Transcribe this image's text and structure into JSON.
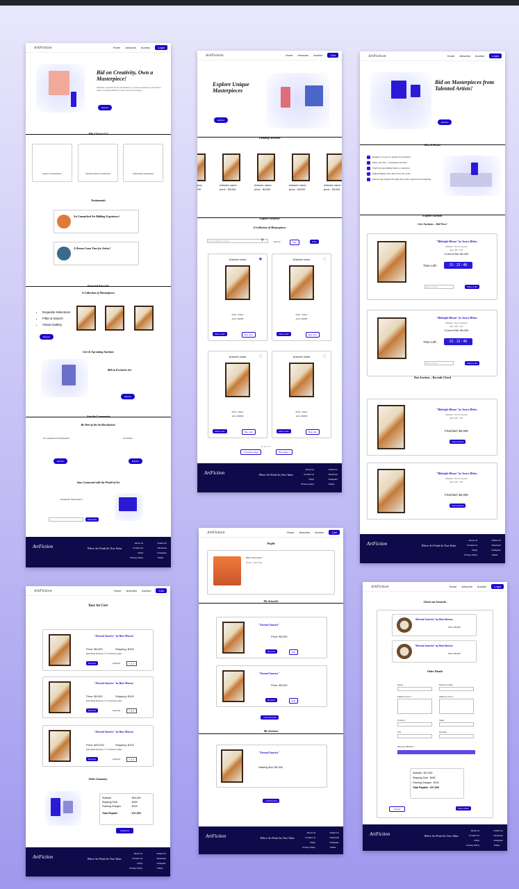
{
  "brand": "ArtFiction",
  "nav": {
    "home": "Home",
    "artworks": "Artworks",
    "auction": "Auction",
    "login": "Login",
    "cart": "Cart"
  },
  "home": {
    "title": "Bid on Creativity, Own a Masterpiece!",
    "hero_text": "Whether a seasoned art enthusiast or a curious newcomer, Art Fiction offers a unique platform to bid, connect and grow.",
    "explore": "Explore",
    "why": "Why Choose Us?",
    "features": [
      "Secure Transactions",
      "Verified Artists & Collectors",
      "Authenticity Guarantee"
    ],
    "testimonials": "Testimonials",
    "t1": "An Unmatched Art Bidding Experience!",
    "t2": "A Dream Come True for Artists!",
    "featured": "Featured Artworks",
    "collection": "A Collection of Masterpieces",
    "bullets": [
      "Exquisite Selections",
      "Filter & Search",
      "Virtual Gallery"
    ],
    "live": "Live & Upcoming Auctions",
    "bid_exclusive": "Bid on Exclusive Art",
    "join": "Join the Community",
    "revolution": "Be Part of the Art Revolution!",
    "collectors": "For Collectors & Enthusiasts",
    "artists": "For Artists",
    "stay": "Stay Connected with the World of Art",
    "newsletter": "Newsletter Subscription",
    "subscribe": "Subscribe"
  },
  "artworks": {
    "title": "Explore Unique Masterpieces",
    "trending": "Trending Artworks",
    "trend_item": "Artwork name",
    "trend_price": "price : $1000",
    "explore": "Explore Artworks",
    "collection": "A Collection of Masterpieces",
    "search_placeholder": "Type something for search",
    "sort": "Sort by :",
    "sort_title": "Title",
    "sort_price": "Price",
    "card_name": "Artwork name",
    "artist": "Artist : Name",
    "price": "price :$1000",
    "add": "Add to cart",
    "buy": "Buy now",
    "prev": "« Previous page",
    "next": "Next page »"
  },
  "auction": {
    "title": "Bid on Masterpieces from Talented Artists!",
    "how": "How It Works",
    "steps": [
      "Register or Log in to access live auctions",
      "Place your bid — transparent and fair",
      "Track the live bidding history in real-time",
      "Highest Bidder wins when the timer ends",
      "Secure your artwork through easy online payment and shipping"
    ],
    "explore": "Explore Auctions",
    "live": "Live Auctions – Bid Now!",
    "lot1": "\"Midnight Bloom\" by Aarya Mehta",
    "lot2": "\"Midnight Bloom\" by Aarya Mehta",
    "medium": "Medium: Oil on Canvas",
    "size": "Size: 30\" x 24\"",
    "current1": "Current Bid: $5,000",
    "current2": "Current Bid: $5,000",
    "time": "Time Left :",
    "timer1": "01 : 12 : 48",
    "timer2": "01 : 12 : 48",
    "enter": "Enter a amount",
    "place": "Place a bid",
    "past": "Past Auctions – Recently Closed",
    "final": "Final Bid: $2,000",
    "view": "View Artwork"
  },
  "cart": {
    "title": "Your Art Cart",
    "item1": "\"Eternal Sunrise\" by Ravi Menon",
    "price1": "Price: $5,000",
    "ship1": "Shipping: $100",
    "price3": "Price: $25,000",
    "delivery": "Estimated Delivery: 5–7 business days",
    "remove": "Remove",
    "qty": "Quantity :",
    "summary": "Order Summary",
    "subtotal": "Subtotal",
    "subtotal_v": ": $33,000",
    "shipping": "Shipping Total",
    "shipping_v": ": $400",
    "framing": "Framing Charges",
    "framing_v": ": $100",
    "payable": "Total Payable",
    "payable_v": ": $17,500",
    "checkout": "Checkout"
  },
  "profile": {
    "title": "Profile",
    "info": "Basic Information :",
    "name": "Name : John Doe",
    "artworks": "My Artworks",
    "art_title": "\"Eternal Sunrise\"",
    "art_price": "Price: $5,000",
    "add_art": "+ Add Artworks",
    "auctions": "My Auctions",
    "start_bid": "Starting Bid: $5,000",
    "add_auction": "+ Add Auction",
    "edit": "Edit"
  },
  "checkout": {
    "title": "Check out Artworks",
    "item": "\"Eternal Sunrise\" by Ravi Menon",
    "price": "Price: $5,000",
    "details": "Order Details",
    "fields": [
      "Name :",
      "Phone number :",
      "Address Line 1 :",
      "Address Line 2 :",
      "Country :",
      "State :",
      "City :",
      "Pincode :"
    ],
    "payment": "Payment Method :",
    "subtotal": "Subtotal : $10,000",
    "shipping": "Shipping Total : $400",
    "framing": "Framing Charges : $100",
    "payable": "Total Payable : $17,500",
    "cancel": "Cancel",
    "place": "Place Order"
  },
  "footer": {
    "tagline": "Where Art Finds Its True Value",
    "links": [
      "About Us",
      "Contact Us",
      "FAQs",
      "Privacy Policy"
    ],
    "follow": "Follow Us",
    "social": [
      "Facebook",
      "Instagram",
      "Twitter"
    ]
  }
}
